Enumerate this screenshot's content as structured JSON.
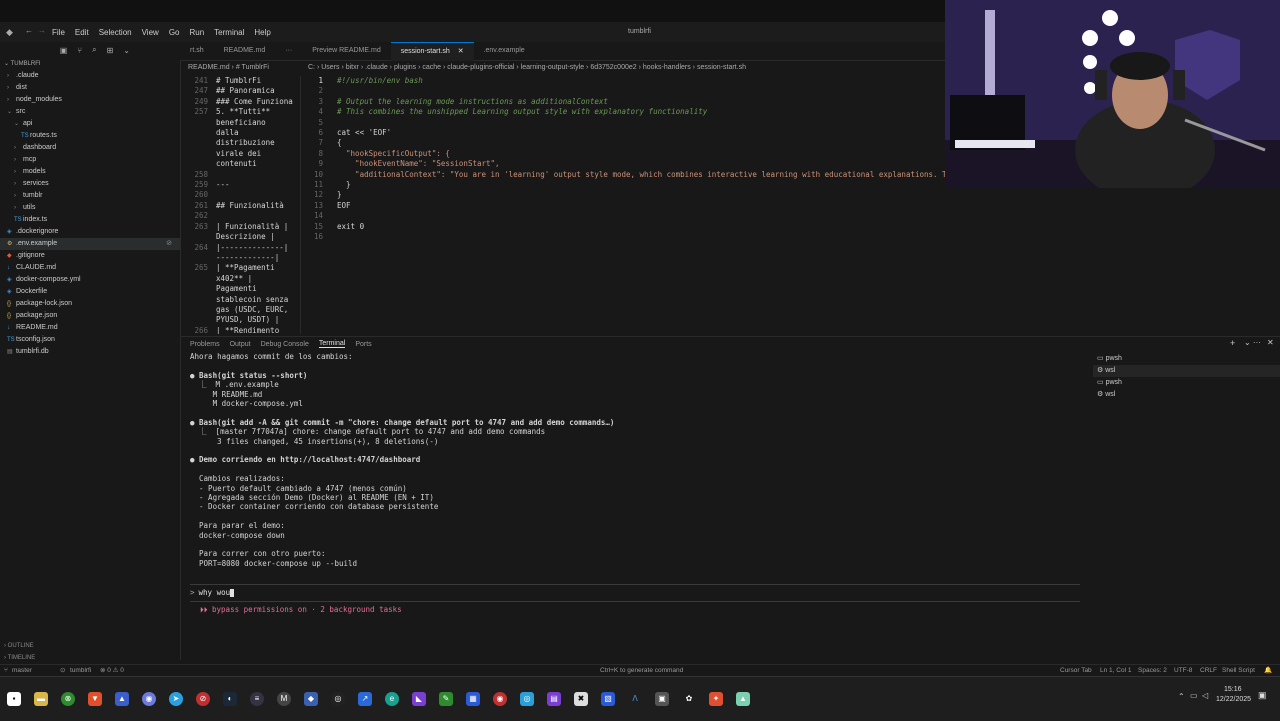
{
  "window": {
    "title": "tumblrfi"
  },
  "menu": [
    "File",
    "Edit",
    "Selection",
    "View",
    "Go",
    "Run",
    "Terminal",
    "Help"
  ],
  "explorer": {
    "root": "TUMBLRFI",
    "items": [
      {
        "label": ".claude",
        "indent": 1,
        "kind": "folder"
      },
      {
        "label": "dist",
        "indent": 1,
        "kind": "folder"
      },
      {
        "label": "node_modules",
        "indent": 1,
        "kind": "folder"
      },
      {
        "label": "src",
        "indent": 1,
        "kind": "folder-open"
      },
      {
        "label": "api",
        "indent": 2,
        "kind": "folder-open"
      },
      {
        "label": "routes.ts",
        "indent": 3,
        "kind": "ts"
      },
      {
        "label": "dashboard",
        "indent": 2,
        "kind": "folder"
      },
      {
        "label": "mcp",
        "indent": 2,
        "kind": "folder"
      },
      {
        "label": "models",
        "indent": 2,
        "kind": "folder"
      },
      {
        "label": "services",
        "indent": 2,
        "kind": "folder"
      },
      {
        "label": "tumblr",
        "indent": 2,
        "kind": "folder"
      },
      {
        "label": "utils",
        "indent": 2,
        "kind": "folder"
      },
      {
        "label": "index.ts",
        "indent": 2,
        "kind": "ts"
      },
      {
        "label": ".dockerignore",
        "indent": 1,
        "kind": "dock"
      },
      {
        "label": ".env.example",
        "indent": 1,
        "kind": "env",
        "selected": true
      },
      {
        "label": ".gitignore",
        "indent": 1,
        "kind": "git"
      },
      {
        "label": "CLAUDE.md",
        "indent": 1,
        "kind": "md"
      },
      {
        "label": "docker-compose.yml",
        "indent": 1,
        "kind": "dock"
      },
      {
        "label": "Dockerfile",
        "indent": 1,
        "kind": "dock"
      },
      {
        "label": "package-lock.json",
        "indent": 1,
        "kind": "json"
      },
      {
        "label": "package.json",
        "indent": 1,
        "kind": "json"
      },
      {
        "label": "README.md",
        "indent": 1,
        "kind": "md"
      },
      {
        "label": "tsconfig.json",
        "indent": 1,
        "kind": "ts"
      },
      {
        "label": "tumblrfi.db",
        "indent": 1,
        "kind": "file"
      }
    ]
  },
  "tabs": [
    {
      "label": "rt.sh",
      "active": false
    },
    {
      "label": "README.md",
      "active": false
    },
    {
      "label": "Preview README.md",
      "active": false
    },
    {
      "label": "session-start.sh",
      "active": true
    },
    {
      "label": ".env.example",
      "active": false
    }
  ],
  "breadcrumbs_left": "README.md  ›  # TumblrFi",
  "breadcrumbs_right": "C: › Users › bitxr › .claude › plugins › cache › claude-plugins-official › learning-output-style › 6d3752c000e2 › hooks-handlers › session-start.sh",
  "md_editor": [
    {
      "ln": "241",
      "text": "# TumblrFi"
    },
    {
      "ln": "247",
      "text": "## Panoramica"
    },
    {
      "ln": "249",
      "text": "### Come Funziona"
    },
    {
      "ln": "257",
      "text": "5. **Tutti**"
    },
    {
      "ln": "",
      "text": "beneficiano"
    },
    {
      "ln": "",
      "text": "dalla"
    },
    {
      "ln": "",
      "text": "distribuzione"
    },
    {
      "ln": "",
      "text": "virale dei"
    },
    {
      "ln": "",
      "text": "contenuti"
    },
    {
      "ln": "258",
      "text": ""
    },
    {
      "ln": "259",
      "text": "---"
    },
    {
      "ln": "260",
      "text": ""
    },
    {
      "ln": "261",
      "text": "## Funzionalità"
    },
    {
      "ln": "262",
      "text": ""
    },
    {
      "ln": "263",
      "text": "| Funzionalità |"
    },
    {
      "ln": "",
      "text": "Descrizione |"
    },
    {
      "ln": "264",
      "text": "|--------------|"
    },
    {
      "ln": "",
      "text": "-------------|"
    },
    {
      "ln": "265",
      "text": "| **Pagamenti"
    },
    {
      "ln": "",
      "text": "x402** |"
    },
    {
      "ln": "",
      "text": "Pagamenti"
    },
    {
      "ln": "",
      "text": "stablecoin senza"
    },
    {
      "ln": "",
      "text": "gas (USDC, EURC,"
    },
    {
      "ln": "",
      "text": "PYUSD, USDT) |"
    },
    {
      "ln": "266",
      "text": "| **Rendimento"
    }
  ],
  "code_editor": [
    {
      "ln": "1",
      "cls": "c-com",
      "text": "#!/usr/bin/env bash"
    },
    {
      "ln": "2",
      "cls": "c-def",
      "text": ""
    },
    {
      "ln": "3",
      "cls": "c-com",
      "text": "# Output the learning mode instructions as additionalContext"
    },
    {
      "ln": "4",
      "cls": "c-com",
      "text": "# This combines the unshipped Learning output style with explanatory functionality"
    },
    {
      "ln": "5",
      "cls": "c-def",
      "text": ""
    },
    {
      "ln": "6",
      "cls": "c-def",
      "text": "cat << 'EOF'"
    },
    {
      "ln": "7",
      "cls": "c-def",
      "text": "{"
    },
    {
      "ln": "8",
      "cls": "c-str",
      "text": "  \"hookSpecificOutput\": {"
    },
    {
      "ln": "9",
      "cls": "c-str",
      "text": "    \"hookEventName\": \"SessionStart\","
    },
    {
      "ln": "10",
      "cls": "c-str",
      "text": "    \"additionalContext\": \"You are in 'learning' output style mode, which combines interactive learning with educational explanations. This mode"
    },
    {
      "ln": "11",
      "cls": "c-def",
      "text": "  }"
    },
    {
      "ln": "12",
      "cls": "c-def",
      "text": "}"
    },
    {
      "ln": "13",
      "cls": "c-def",
      "text": "EOF"
    },
    {
      "ln": "14",
      "cls": "c-def",
      "text": ""
    },
    {
      "ln": "15",
      "cls": "c-def",
      "text": "exit 0"
    },
    {
      "ln": "16",
      "cls": "c-def",
      "text": ""
    }
  ],
  "panel_tabs": [
    "Problems",
    "Output",
    "Debug Console",
    "Terminal",
    "Ports"
  ],
  "terminal_lines": [
    "Ahora hagamos commit de los cambios:",
    "",
    "● Bash(git status --short)",
    "  ⎿  M .env.example",
    "     M README.md",
    "     M docker-compose.yml",
    "",
    "● Bash(git add -A && git commit -m \"chore: change default port to 4747 and add demo commands…)",
    "  ⎿  [master 7f7047a] chore: change default port to 4747 and add demo commands",
    "      3 files changed, 45 insertions(+), 8 deletions(-)",
    "",
    "● Demo corriendo en http://localhost:4747/dashboard",
    "",
    "  Cambios realizados:",
    "  - Puerto default cambiado a 4747 (menos común)",
    "  - Agregada sección Demo (Docker) al README (EN + IT)",
    "  - Docker container corriendo con database persistente",
    "",
    "  Para parar el demo:",
    "  docker-compose down",
    "",
    "  Para correr con otro puerto:",
    "  PORT=8080 docker-compose up --build"
  ],
  "prompt": {
    "symbol": ">",
    "text": "why wou"
  },
  "status_line": "⏵⏵ bypass permissions on · 2 background tasks",
  "terminal_list": [
    {
      "label": "pwsh",
      "selected": false
    },
    {
      "label": "wsl",
      "selected": true
    },
    {
      "label": "pwsh",
      "selected": false
    },
    {
      "label": "wsl",
      "selected": false
    }
  ],
  "outline": {
    "outline": "OUTLINE",
    "timeline": "TIMELINE"
  },
  "statusbar": {
    "branch": "master",
    "repo": "tumblrfi",
    "problems": "⊗ 0  ⚠ 0",
    "hint": "Ctrl+K to generate command",
    "cursor_tab": "Cursor Tab",
    "position": "Ln 1, Col 1",
    "spaces": "Spaces: 2",
    "encoding": "UTF-8",
    "eol": "CRLF",
    "language": "Shell Script"
  },
  "taskbar": {
    "time": "15:16",
    "date": "12/22/2025"
  },
  "colors": {
    "accent": "#0078d4",
    "prompt_status": "#e36e9a"
  }
}
